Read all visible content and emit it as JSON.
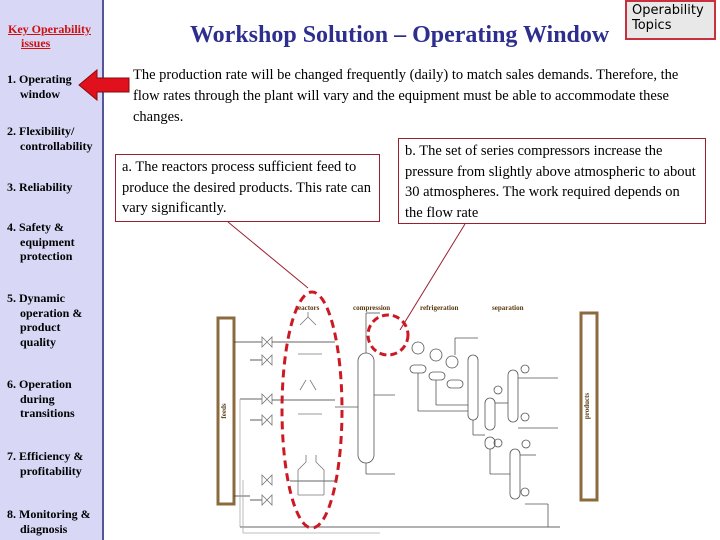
{
  "sidebar": {
    "title_line1": "Key Operability",
    "title_line2": "issues",
    "items": [
      {
        "num": "1. Operating",
        "rest": [
          "window"
        ]
      },
      {
        "num": "2. Flexibility/",
        "rest": [
          "controllability"
        ]
      },
      {
        "num": "3. Reliability",
        "rest": []
      },
      {
        "num": "4. Safety &",
        "rest": [
          "equipment",
          "protection"
        ]
      },
      {
        "num": "5. Dynamic",
        "rest": [
          "operation &",
          "product",
          "quality"
        ]
      },
      {
        "num": "6. Operation",
        "rest": [
          "during",
          "transitions"
        ]
      },
      {
        "num": "7. Efficiency &",
        "rest": [
          "profitability"
        ]
      },
      {
        "num": "8. Monitoring &",
        "rest": [
          "diagnosis"
        ]
      }
    ],
    "active_item": "1. Operating window"
  },
  "header": {
    "title": "Workshop Solution – Operating Window",
    "topics_button_line1": "Operability",
    "topics_button_line2": "Topics"
  },
  "intro_text": "The production rate will be changed frequently (daily) to match sales demands. Therefore, the flow rates through the plant will vary and the equipment must be able to accommodate these changes.",
  "callouts": {
    "a": "a.  The reactors process sufficient feed to produce the desired products.  This rate can vary significantly.",
    "b": "b.  The set of series compressors increase the pressure from slightly above atmospheric to about 30 atmospheres.  The work required depends on the flow rate"
  },
  "diagram": {
    "section_labels": [
      "reactors",
      "compression",
      "refrigeration",
      "separation"
    ],
    "feeds_label": "feeds",
    "products_label": "products",
    "colors": {
      "highlight": "#cc1a24",
      "box_border": "#8b6a3e",
      "title": "#2e2e8f"
    }
  }
}
